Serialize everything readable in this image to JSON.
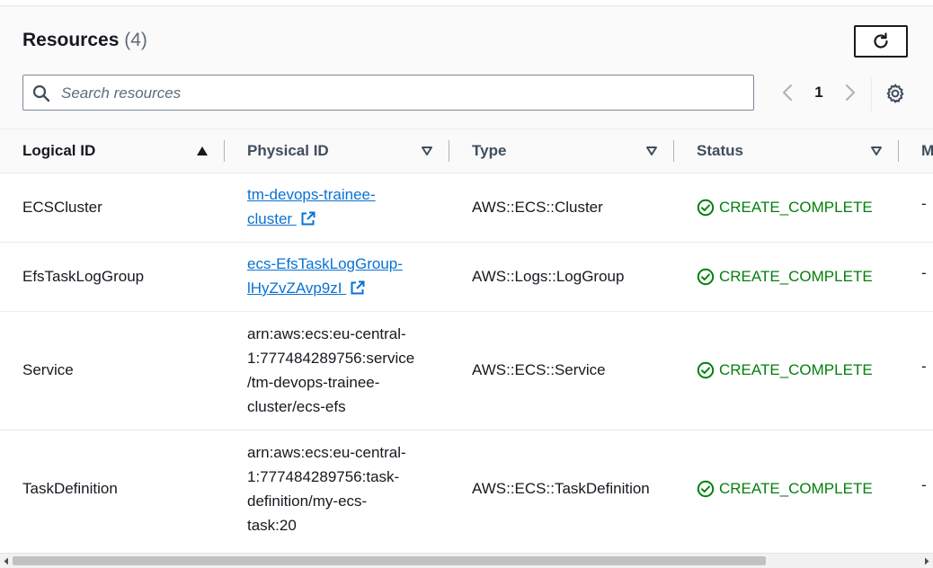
{
  "header": {
    "title": "Resources",
    "count": "(4)",
    "refresh_icon": "refresh-icon"
  },
  "search": {
    "placeholder": "Search resources",
    "value": ""
  },
  "pagination": {
    "current_page": "1"
  },
  "table": {
    "columns": [
      {
        "label": "Logical ID",
        "sort": "ascending"
      },
      {
        "label": "Physical ID",
        "sort": "none"
      },
      {
        "label": "Type",
        "sort": "none"
      },
      {
        "label": "Status",
        "sort": "none"
      },
      {
        "label": "M"
      }
    ],
    "rows": [
      {
        "logical_id": "ECSCluster",
        "physical_line1": "tm-devops-trainee-",
        "physical_line2": "cluster",
        "type": "AWS::ECS::Cluster",
        "status": "CREATE_COMPLETE",
        "extra": "-"
      },
      {
        "logical_id": "EfsTaskLogGroup",
        "physical_line1": "ecs-EfsTaskLogGroup-",
        "physical_line2": "lHyZvZAvp9zI",
        "type": "AWS::Logs::LogGroup",
        "status": "CREATE_COMPLETE",
        "extra": "-"
      },
      {
        "logical_id": "Service",
        "physical_line1": "arn:aws:ecs:eu-central-",
        "physical_line2": "1:777484289756:service",
        "physical_line3": "/tm-devops-trainee-",
        "physical_line4": "cluster/ecs-efs",
        "type": "AWS::ECS::Service",
        "status": "CREATE_COMPLETE",
        "extra": "-"
      },
      {
        "logical_id": "TaskDefinition",
        "physical_line1": "arn:aws:ecs:eu-central-",
        "physical_line2": "1:777484289756:task-",
        "physical_line3": "definition/my-ecs-",
        "physical_line4": "task:20",
        "type": "AWS::ECS::TaskDefinition",
        "status": "CREATE_COMPLETE",
        "extra": "-"
      }
    ]
  },
  "colors": {
    "link": "#0972d3",
    "success": "#037f0c",
    "text": "#16191f",
    "header_bg": "#fafafa"
  }
}
